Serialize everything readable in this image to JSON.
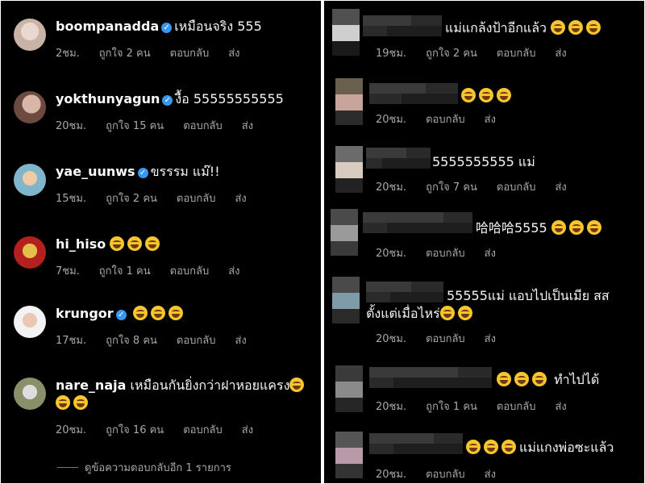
{
  "left": {
    "comments": [
      {
        "username": "boompanadda",
        "verified": true,
        "text": "เหมือนจริง 555",
        "emoji": 0,
        "time": "2ชม.",
        "likes": "ถูกใจ 2 คน",
        "reply": "ตอบกลับ",
        "send": "ส่ง"
      },
      {
        "username": "yokthunyagun",
        "verified": true,
        "text": "งื้อ 55555555555",
        "emoji": 0,
        "time": "20ชม.",
        "likes": "ถูกใจ 15 คน",
        "reply": "ตอบกลับ",
        "send": "ส่ง"
      },
      {
        "username": "yae_uunws",
        "verified": true,
        "text": "ขรรรม แม๊!!",
        "emoji": 0,
        "time": "15ชม.",
        "likes": "ถูกใจ 2 คน",
        "reply": "ตอบกลับ",
        "send": "ส่ง"
      },
      {
        "username": "hi_hiso",
        "verified": false,
        "text": "",
        "emoji": 3,
        "time": "7ชม.",
        "likes": "ถูกใจ 1 คน",
        "reply": "ตอบกลับ",
        "send": "ส่ง"
      },
      {
        "username": "krungor",
        "verified": true,
        "text": "",
        "emoji": 3,
        "time": "17ชม.",
        "likes": "ถูกใจ 8 คน",
        "reply": "ตอบกลับ",
        "send": "ส่ง"
      },
      {
        "username": "nare_naja",
        "verified": false,
        "text": "เหมือนกันยิ่งกว่าฝาหอยแครง",
        "emoji": 3,
        "time": "20ชม.",
        "likes": "ถูกใจ 16 คน",
        "reply": "ตอบกลับ",
        "send": "ส่ง"
      }
    ],
    "view_more": "ดูข้อความตอบกลับอีก 1 รายการ"
  },
  "right": {
    "comments": [
      {
        "text": "แม่แกล้งป้าอีกแล้ว",
        "emoji": 3,
        "time": "19ชม.",
        "likes": "ถูกใจ 2 คน",
        "reply": "ตอบกลับ",
        "send": "ส่ง"
      },
      {
        "text": "",
        "emoji": 3,
        "time": "20ชม.",
        "likes": "",
        "reply": "ตอบกลับ",
        "send": "ส่ง"
      },
      {
        "text": "5555555555 แม่",
        "emoji": 0,
        "time": "20ชม.",
        "likes": "ถูกใจ 7 คน",
        "reply": "ตอบกลับ",
        "send": "ส่ง"
      },
      {
        "text": "哈哈哈5555",
        "emoji": 3,
        "time": "20ชม.",
        "likes": "",
        "reply": "ตอบกลับ",
        "send": "ส่ง"
      },
      {
        "text": "55555แม่ แอบไปเป็นเมีย สส",
        "text2": "ตั้งแต่เมื่อไหร่",
        "emoji": 2,
        "time": "20ชม.",
        "likes": "",
        "reply": "ตอบกลับ",
        "send": "ส่ง"
      },
      {
        "text": "ทำไปได้",
        "emoji": 3,
        "time": "20ชม.",
        "likes": "ถูกใจ 1 คน",
        "reply": "ตอบกลับ",
        "send": "ส่ง"
      },
      {
        "text": "แม่แกงพ่อซะแล้ว",
        "emoji": 3,
        "time": "20ชม.",
        "likes": "",
        "reply": "ตอบกลับ",
        "send": "ส่ง"
      }
    ]
  },
  "colors": {
    "background": "#000000",
    "text": "#f5f5f5",
    "meta": "#a8a8a8",
    "verified": "#3897f0",
    "emoji": "#f7c52d"
  }
}
